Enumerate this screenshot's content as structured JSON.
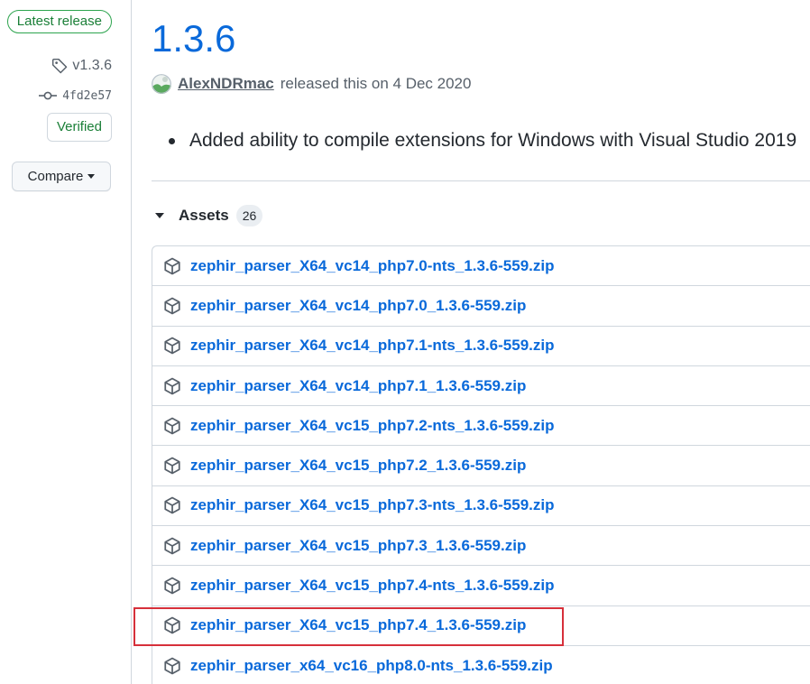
{
  "sidebar": {
    "latest_badge": "Latest release",
    "tag": "v1.3.6",
    "commit": "4fd2e57",
    "verified": "Verified",
    "compare_label": "Compare"
  },
  "release": {
    "title": "1.3.6",
    "author": "AlexNDRmac",
    "released_text": "released this on 4 Dec 2020",
    "notes": [
      "Added ability to compile extensions for Windows with Visual Studio 2019"
    ]
  },
  "assets": {
    "label": "Assets",
    "count": "26",
    "items": [
      "zephir_parser_X64_vc14_php7.0-nts_1.3.6-559.zip",
      "zephir_parser_X64_vc14_php7.0_1.3.6-559.zip",
      "zephir_parser_X64_vc14_php7.1-nts_1.3.6-559.zip",
      "zephir_parser_X64_vc14_php7.1_1.3.6-559.zip",
      "zephir_parser_X64_vc15_php7.2-nts_1.3.6-559.zip",
      "zephir_parser_X64_vc15_php7.2_1.3.6-559.zip",
      "zephir_parser_X64_vc15_php7.3-nts_1.3.6-559.zip",
      "zephir_parser_X64_vc15_php7.3_1.3.6-559.zip",
      "zephir_parser_X64_vc15_php7.4-nts_1.3.6-559.zip",
      "zephir_parser_X64_vc15_php7.4_1.3.6-559.zip",
      "zephir_parser_x64_vc16_php8.0-nts_1.3.6-559.zip"
    ]
  },
  "colors": {
    "link": "#0969da",
    "verified": "#1a7f37",
    "highlight": "#d6303a",
    "border": "#d0d7de"
  }
}
